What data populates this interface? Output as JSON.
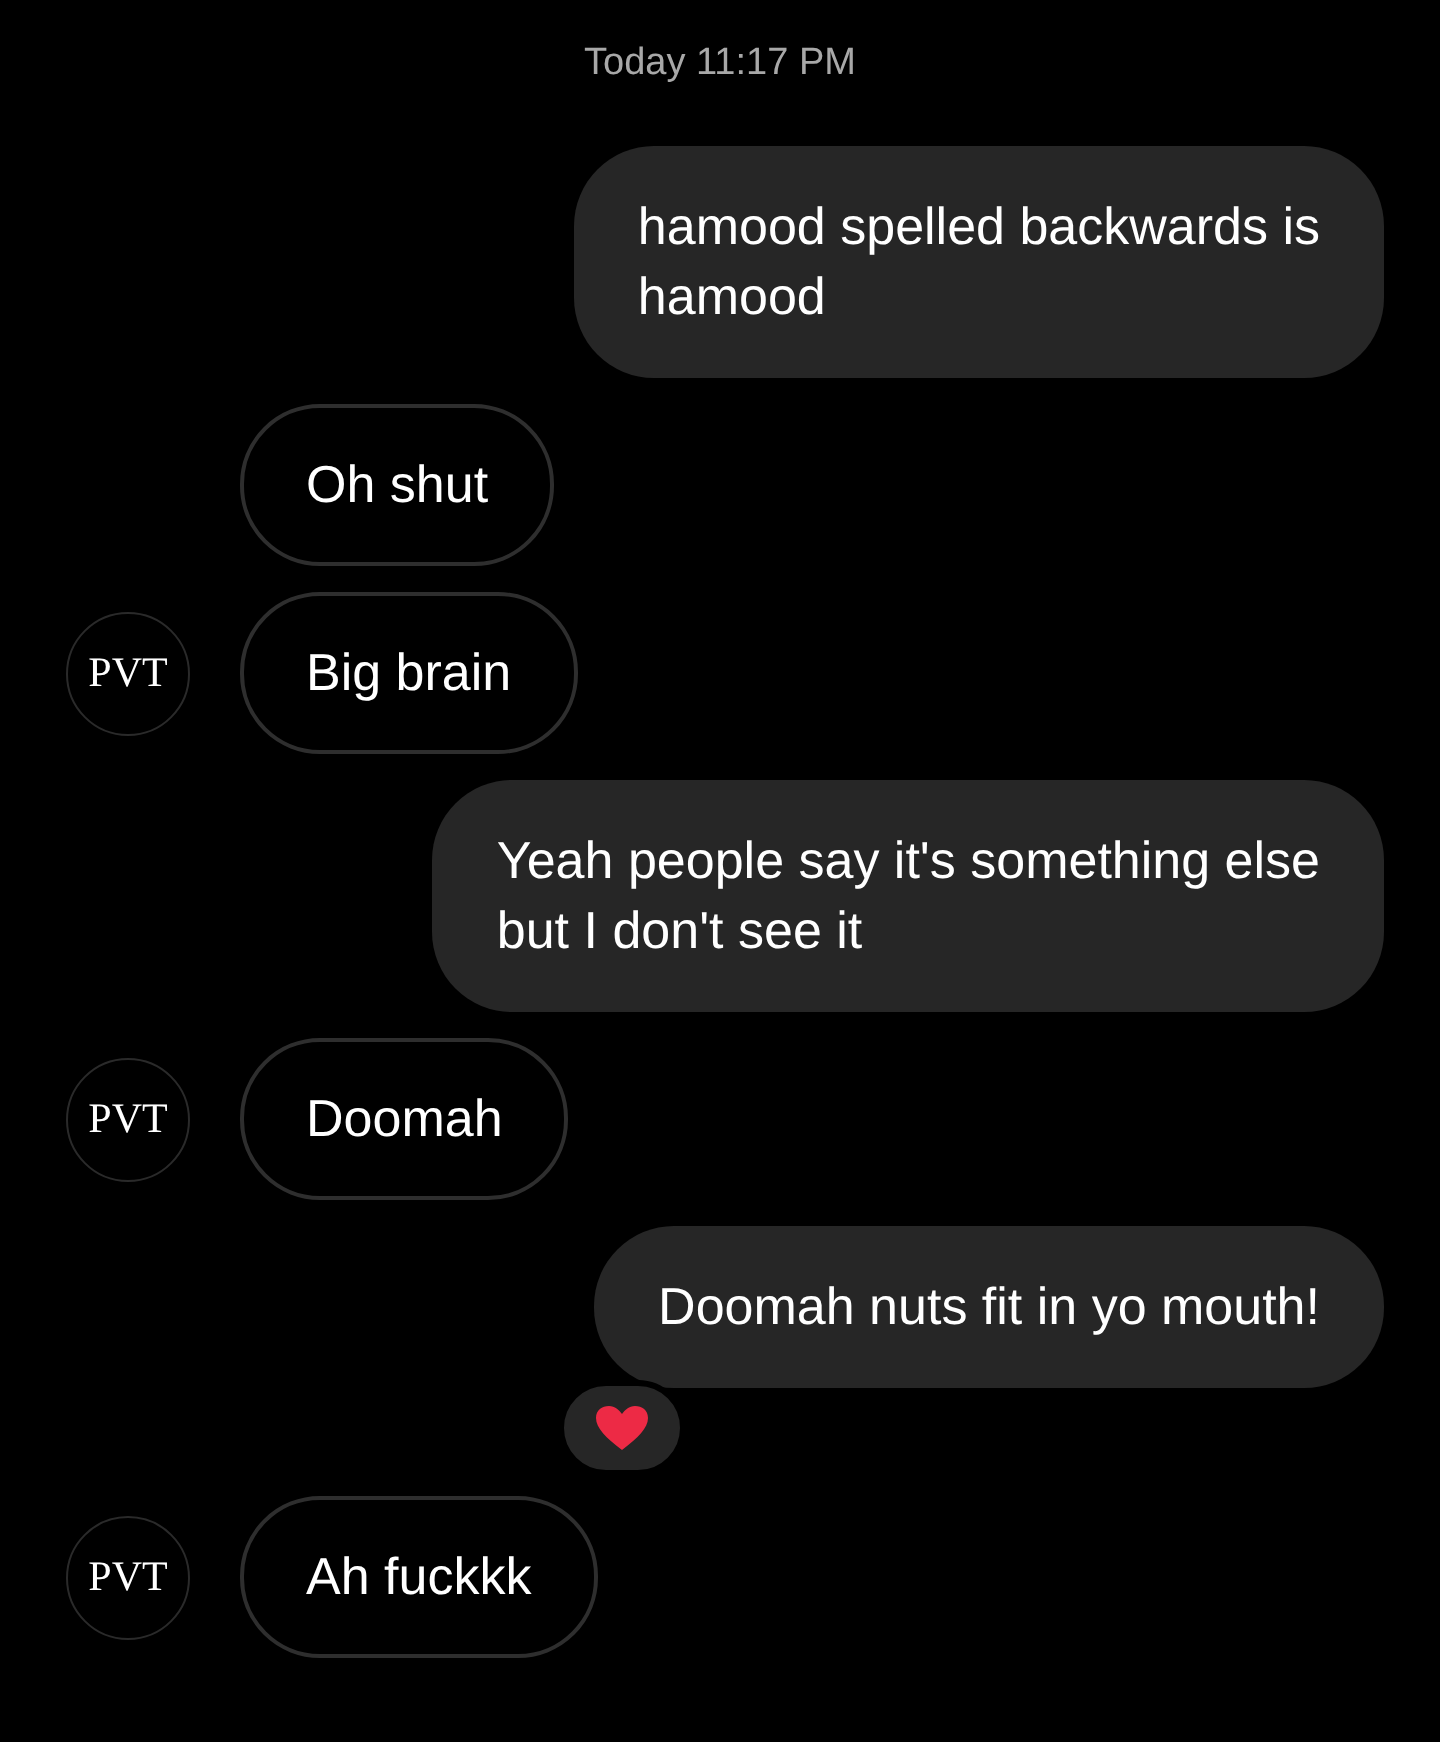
{
  "timestamp": "Today 11:17 PM",
  "messages": [
    {
      "kind": "sent",
      "text": "hamood spelled backwards is\nhamood"
    },
    {
      "kind": "received",
      "text": "Oh shut"
    },
    {
      "kind": "received",
      "text": "Big brain",
      "avatar": "PVT"
    },
    {
      "kind": "sent",
      "text": "Yeah people say it's something else\nbut I don't see it"
    },
    {
      "kind": "received",
      "text": "Doomah",
      "avatar": "PVT"
    },
    {
      "kind": "sent",
      "text": "Doomah nuts fit in yo mouth!",
      "heart_reaction": true
    },
    {
      "kind": "received",
      "text": "Ah fuckkk",
      "avatar": "PVT"
    }
  ]
}
